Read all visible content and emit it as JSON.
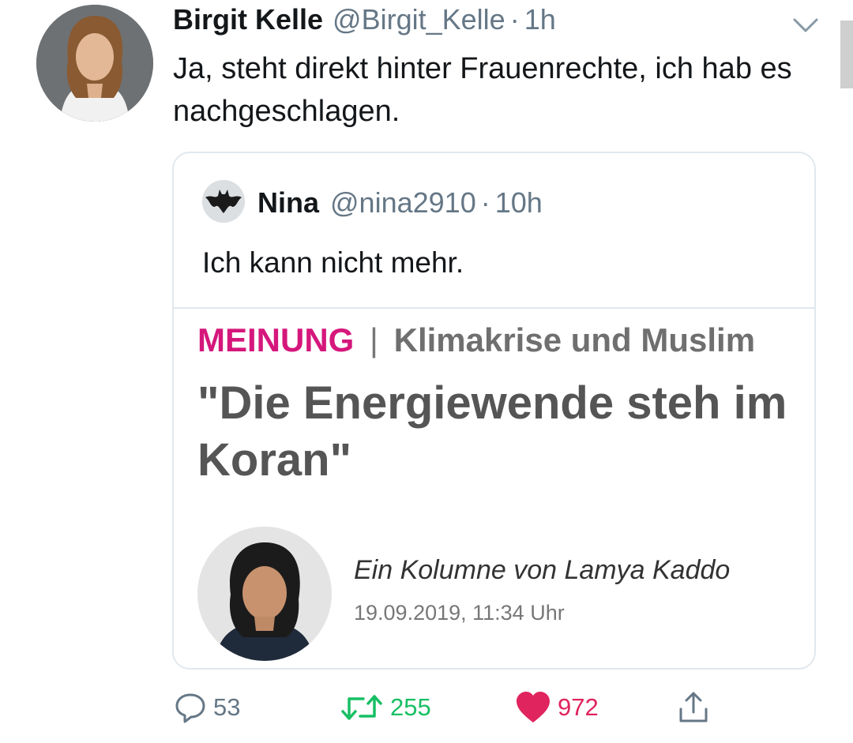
{
  "tweet": {
    "author_name": "Birgit Kelle",
    "author_handle": "@Birgit_Kelle",
    "separator": "·",
    "time": "1h",
    "text": "Ja, steht direkt hinter Frauenrechte, ich hab es nachgeschlagen."
  },
  "quoted_tweet": {
    "author_name": "Nina",
    "author_handle": "@nina2910",
    "separator": "·",
    "time": "10h",
    "text": "Ich kann nicht mehr.",
    "article": {
      "kicker_label": "MEINUNG",
      "kicker_separator": "|",
      "kicker_topic": "Klimakrise und Muslim",
      "headline": "\"Die Energiewende steh im Koran\"",
      "byline": "Ein Kolumne von Lamya Kaddo",
      "date": "19.09.2019, 11:34 Uhr"
    }
  },
  "actions": {
    "reply_count": "53",
    "retweet_count": "255",
    "like_count": "972"
  },
  "colors": {
    "kicker": "#d5177c",
    "retweet": "#17bf63",
    "like": "#e0245e",
    "secondary_text": "#657786"
  },
  "icons": [
    "chevron-down-icon",
    "reply-icon",
    "retweet-icon",
    "heart-icon",
    "share-icon"
  ]
}
